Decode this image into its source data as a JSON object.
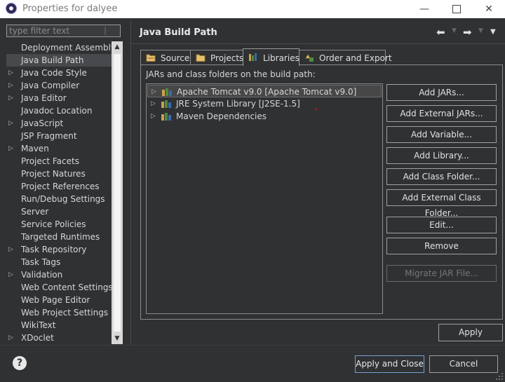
{
  "window": {
    "title": "Properties for dalyee",
    "minimize": "—",
    "close": "✕"
  },
  "filter": {
    "placeholder": "type filter text"
  },
  "sidebar": {
    "items": [
      {
        "label": "Deployment Assembly",
        "expandable": false
      },
      {
        "label": "Java Build Path",
        "expandable": false,
        "selected": true
      },
      {
        "label": "Java Code Style",
        "expandable": true
      },
      {
        "label": "Java Compiler",
        "expandable": true
      },
      {
        "label": "Java Editor",
        "expandable": true
      },
      {
        "label": "Javadoc Location",
        "expandable": false
      },
      {
        "label": "JavaScript",
        "expandable": true
      },
      {
        "label": "JSP Fragment",
        "expandable": false
      },
      {
        "label": "Maven",
        "expandable": true
      },
      {
        "label": "Project Facets",
        "expandable": false
      },
      {
        "label": "Project Natures",
        "expandable": false
      },
      {
        "label": "Project References",
        "expandable": false
      },
      {
        "label": "Run/Debug Settings",
        "expandable": false
      },
      {
        "label": "Server",
        "expandable": false
      },
      {
        "label": "Service Policies",
        "expandable": false
      },
      {
        "label": "Targeted Runtimes",
        "expandable": false
      },
      {
        "label": "Task Repository",
        "expandable": true
      },
      {
        "label": "Task Tags",
        "expandable": false
      },
      {
        "label": "Validation",
        "expandable": true
      },
      {
        "label": "Web Content Settings",
        "expandable": false
      },
      {
        "label": "Web Page Editor",
        "expandable": false
      },
      {
        "label": "Web Project Settings",
        "expandable": false
      },
      {
        "label": "WikiText",
        "expandable": false
      },
      {
        "label": "XDoclet",
        "expandable": true
      }
    ]
  },
  "page": {
    "title": "Java Build Path",
    "tabs": [
      {
        "label": "Source",
        "icon": "source-folder-icon"
      },
      {
        "label": "Projects",
        "icon": "projects-folder-icon"
      },
      {
        "label": "Libraries",
        "icon": "libraries-icon",
        "active": true
      },
      {
        "label": "Order and Export",
        "icon": "order-export-icon"
      }
    ],
    "path_label": "JARs and class folders on the build path:",
    "libraries": [
      {
        "label": "Apache Tomcat v9.0 [Apache Tomcat v9.0]",
        "selected": true
      },
      {
        "label": "JRE System Library [J2SE-1.5]"
      },
      {
        "label": "Maven Dependencies"
      }
    ],
    "buttons": {
      "add_jars": "Add JARs...",
      "add_external_jars": "Add External JARs...",
      "add_variable": "Add Variable...",
      "add_library": "Add Library...",
      "add_class_folder": "Add Class Folder...",
      "add_external_class_folder": "Add External Class Folder...",
      "edit": "Edit...",
      "remove": "Remove",
      "migrate_jar": "Migrate JAR File..."
    },
    "apply": "Apply"
  },
  "footer": {
    "help": "?",
    "apply_and_close": "Apply and Close",
    "cancel": "Cancel"
  },
  "colors": {
    "background": "#2f3133",
    "accent_border": "#7aa0d4",
    "text": "#d6d6d6"
  }
}
